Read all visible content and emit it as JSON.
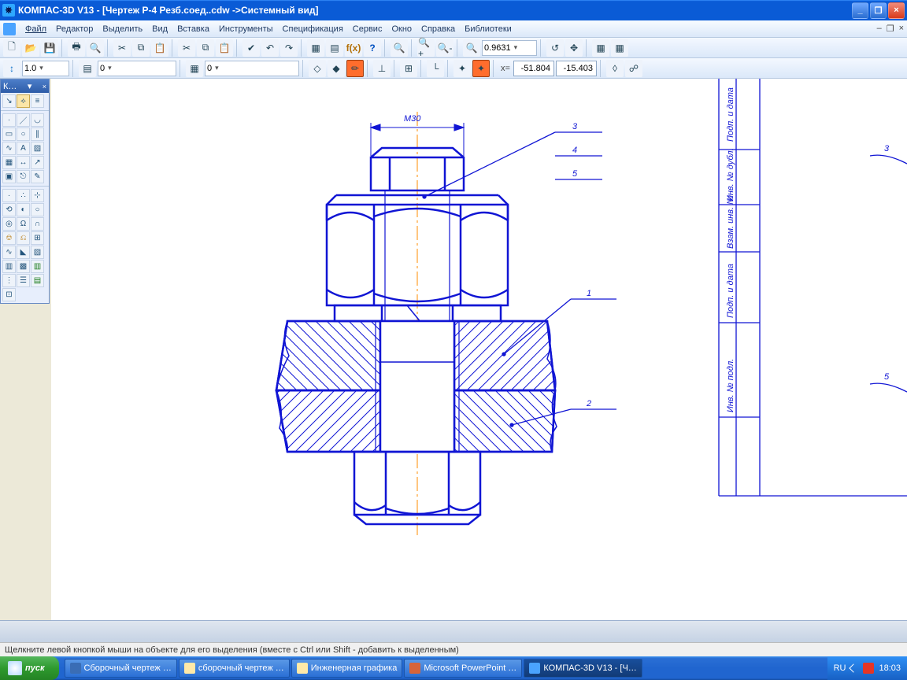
{
  "window": {
    "title": "КОМПАС-3D V13 - [Чертеж Р-4 Резб.соед..cdw ->Системный вид]"
  },
  "menu": {
    "items": [
      "Файл",
      "Редактор",
      "Выделить",
      "Вид",
      "Вставка",
      "Инструменты",
      "Спецификация",
      "Сервис",
      "Окно",
      "Справка",
      "Библиотеки"
    ]
  },
  "toolbar2": {
    "zoom": "0.9631"
  },
  "toolbar3": {
    "val1": "1.0",
    "val2": "0",
    "val3": "0",
    "coordLabel": "x=",
    "coordX": "-51.804",
    "coordY": "-15.403"
  },
  "compactPanel": {
    "title": "К…",
    "pin": "▾",
    "close": "×"
  },
  "drawing": {
    "dim": "М30",
    "balloons": [
      "3",
      "4",
      "5",
      "1",
      "2"
    ],
    "sideBalloons": [
      "3",
      "5"
    ],
    "titleColumns": [
      "Подп. и дата",
      "Инв. № дубл.",
      "Взам. инв. №",
      "Подп. и дата",
      "Инв. № подл."
    ]
  },
  "status": {
    "text": "Щелкните левой кнопкой мыши на объекте для его выделения (вместе с Ctrl или Shift - добавить к выделенным)"
  },
  "taskbar": {
    "start": "пуск",
    "items": [
      "Сборочный чертеж …",
      "сборочный чертеж …",
      "Инженерная графика",
      "Microsoft PowerPoint …",
      "КОМПАС-3D V13 - [Ч…"
    ],
    "lang": "RU",
    "time": "18:03"
  }
}
